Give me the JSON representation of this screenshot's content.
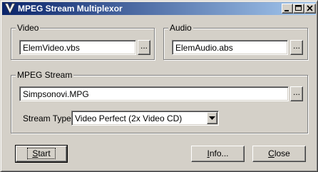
{
  "window": {
    "title": "MPEG Stream Multiplexor"
  },
  "video": {
    "label": "Video",
    "file": "ElemVideo.vbs",
    "browse_label": "..."
  },
  "audio": {
    "label": "Audio",
    "file": "ElemAudio.abs",
    "browse_label": "..."
  },
  "mpeg": {
    "label": "MPEG Stream",
    "file": "Simpsonovi.MPG",
    "browse_label": "...",
    "stream_type_label": "Stream Type:",
    "stream_type_value": "Video Perfect (2x Video CD)"
  },
  "buttons": {
    "start_mnemonic": "S",
    "start_rest": "tart",
    "info_mnemonic": "I",
    "info_rest": "nfo...",
    "close_mnemonic": "C",
    "close_rest": "lose"
  },
  "colors": {
    "title_start": "#0a246a",
    "title_end": "#a6caf0",
    "face": "#d4d0c8"
  }
}
